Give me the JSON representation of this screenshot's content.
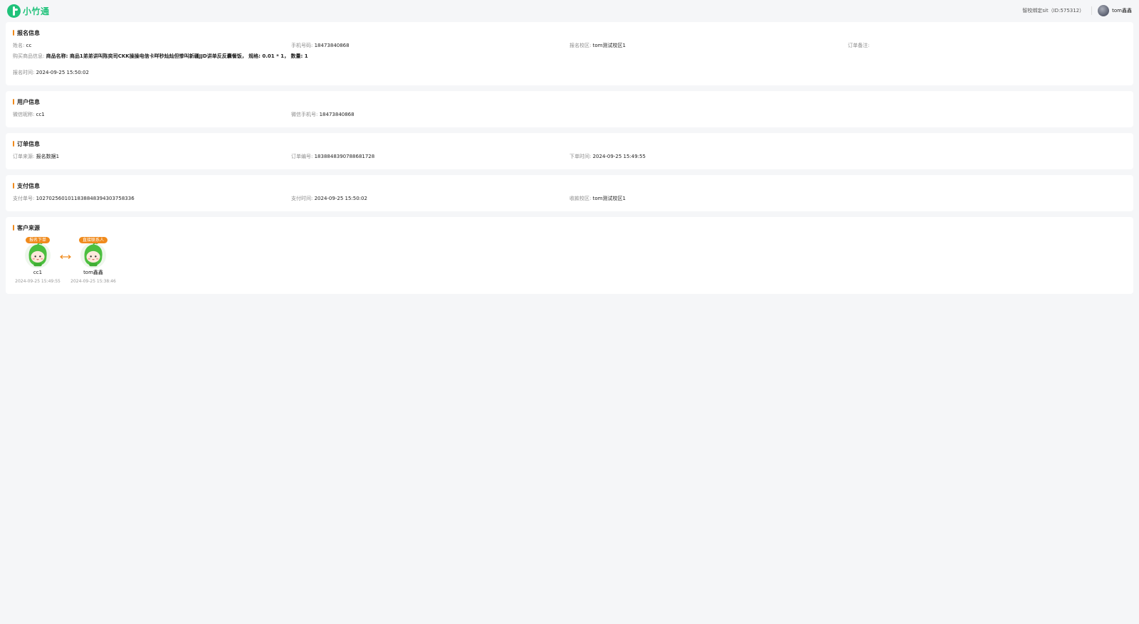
{
  "header": {
    "logo_text": "小竹通",
    "campus": "智校绑定sit（ID:575312）",
    "username": "tom鑫鑫"
  },
  "registration": {
    "title": "报名信息",
    "name_label": "姓名:",
    "name": "cc",
    "phone_label": "手机号码:",
    "phone": "18473840868",
    "campus_label": "报名校区:",
    "campus": "tom测试校区1",
    "remark_label": "订单备注:",
    "remark": "",
    "product_label": "购买商品信息:",
    "product": "商品名称: 商品1弟弟讲叫陈奕司CKK操操电信卡咩秒灿灿但惨叫新疆JJD讲单反反囊餐饭， 规格: 0.01 * 1， 数量: 1",
    "time_label": "报名时间:",
    "time": "2024-09-25 15:50:02"
  },
  "user": {
    "title": "用户信息",
    "nickname_label": "微信昵称:",
    "nickname": "cc1",
    "wxphone_label": "微信手机号:",
    "wxphone": "18473840868"
  },
  "order": {
    "title": "订单信息",
    "source_label": "订单来源:",
    "source": "报名数据1",
    "no_label": "订单编号:",
    "no": "1838848390788681728",
    "time_label": "下单时间:",
    "time": "2024-09-25 15:49:55"
  },
  "payment": {
    "title": "支付信息",
    "no_label": "支付单号:",
    "no": "1027025601011838848394303758336",
    "time_label": "支付时间:",
    "time": "2024-09-25 15:50:02",
    "campus_label": "收款校区:",
    "campus": "tom测试校区1"
  },
  "customer_source": {
    "title": "客户来源",
    "nodes": [
      {
        "tag": "报名下单",
        "name": "cc1",
        "time": "2024-09-25 15:49:55"
      },
      {
        "tag": "直接联系人",
        "name": "tom鑫鑫",
        "time": "2024-09-25 15:38:46"
      }
    ],
    "accent_color": "#f08a1c",
    "mascot_color": "#4cbf3f"
  }
}
